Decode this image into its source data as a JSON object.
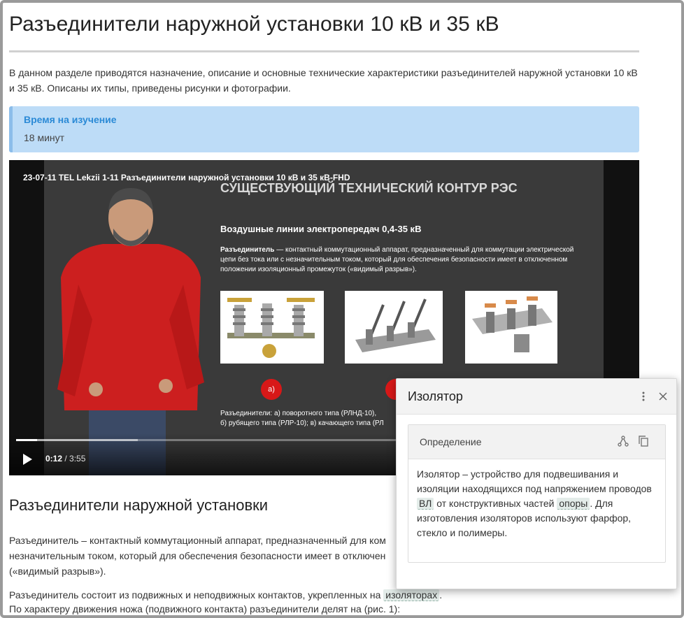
{
  "page": {
    "title": "Разъединители наружной установки 10 кВ и 35 кВ",
    "lead": "В данном разделе приводятся назначение, описание и основные технические характеристики разъединителей наружной установки 10 кВ и 35 кВ. Описаны их типы, приведены рисунки и фотографии.",
    "callout": {
      "title": "Время на изучение",
      "value": "18 минут"
    }
  },
  "video": {
    "title": "23-07-11 TEL Lekzii 1-11 Разъединители наружной установки 10 кВ и 35 кВ-FHD",
    "slide_title": "СУЩЕСТВУЮЩИЙ ТЕХНИЧЕСКИЙ КОНТУР РЭС",
    "slide_subtitle": "Воздушные линии электропередач 0,4-35 кВ",
    "slide_term": "Разъединитель",
    "slide_text": " — контактный коммутационный аппарат, предназначенный для коммутации электрической цепи без тока или с незначительным током, который для обеспечения безопасности имеет в отключенном положении изоляционный промежуток («видимый разрыв»).",
    "badge_a": "а)",
    "caption_line1": "Разъединители: а) поворотного типа (РЛНД-10),",
    "caption_line2": "б) рубящего типа (РЛР-10); в) качающего типа (РЛ",
    "current_time": "0:12",
    "duration": "/ 3:55",
    "progress": 0.054,
    "buffered": 0.31
  },
  "section": {
    "heading": "Разъединители наружной установки",
    "p1_line1": "Разъединитель – контактный коммутационный аппарат, предназначенный для ком",
    "p1_line2": "незначительным током, который для обеспечения безопасности имеет в отключен",
    "p1_line3": "(«видимый разрыв»).",
    "p2_line1_before": "Разъединитель состоит из подвижных и неподвижных контактов, укрепленных на",
    "p2_tag": "изоляторах",
    "p2_line1_after": ".",
    "p2_line2": "По характеру движения ножа (подвижного контакта) разъединители делят на (рис. 1):"
  },
  "popup": {
    "title": "Изолятор",
    "card_title": "Определение",
    "text_before": "Изолятор – устройство для подвешивания и изоляции находящихся под напряжением проводов ",
    "tag1": "ВЛ",
    "text_mid": " от конструктивных частей ",
    "tag2": "опоры",
    "text_after": ". Для изготовления изоляторов используют фарфор, стекло и полимеры."
  }
}
